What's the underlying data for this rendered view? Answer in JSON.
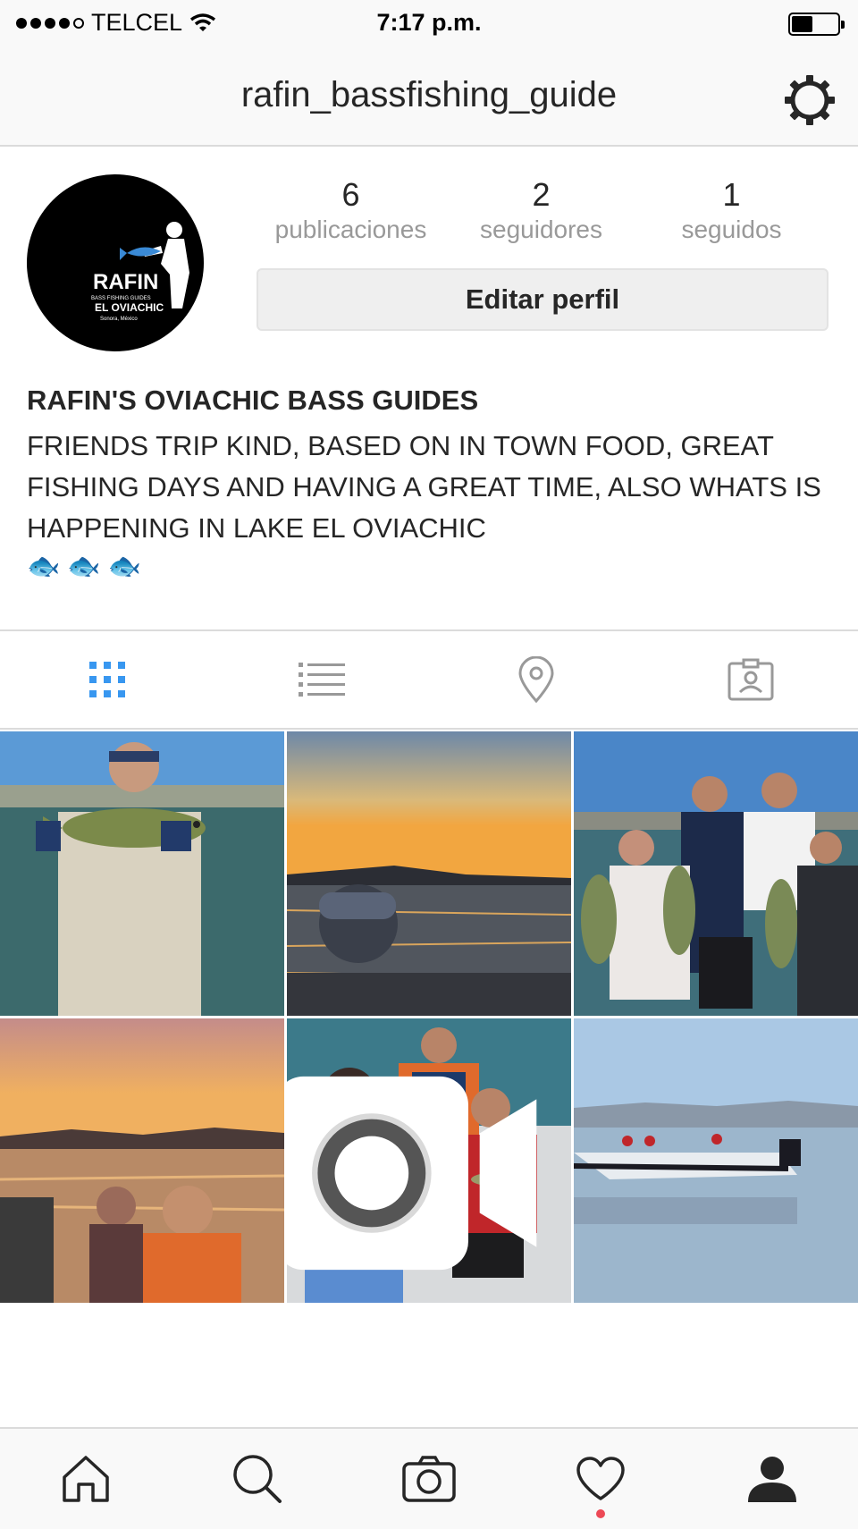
{
  "status_bar": {
    "carrier": "TELCEL",
    "time": "7:17 p.m.",
    "battery_level": 0.45
  },
  "header": {
    "username": "rafin_bassfishing_guide"
  },
  "profile": {
    "avatar_logo_text": "RAFIN BASS FISHING GUIDES EL OVIACHIC Sonora, México",
    "stats": [
      {
        "value": "6",
        "label": "publicaciones"
      },
      {
        "value": "2",
        "label": "seguidores"
      },
      {
        "value": "1",
        "label": "seguidos"
      }
    ],
    "edit_button": "Editar perfil",
    "bio_name": "RAFIN'S OVIACHIC BASS GUIDES",
    "bio_text": "FRIENDS TRIP KIND, BASED ON IN TOWN FOOD, GREAT FISHING DAYS AND HAVING A GREAT TIME, ALSO WHATS IS HAPPENING IN LAKE EL OVIACHIC",
    "bio_emojis": [
      "🐟",
      "🐟",
      "🐟"
    ]
  },
  "tabs": [
    {
      "icon": "grid-icon",
      "active": true
    },
    {
      "icon": "list-icon",
      "active": false
    },
    {
      "icon": "location-pin-icon",
      "active": false
    },
    {
      "icon": "tagged-person-icon",
      "active": false
    }
  ],
  "posts": [
    {
      "scene": "man holding bass on boat",
      "type": "photo"
    },
    {
      "scene": "sunset over lake",
      "type": "photo"
    },
    {
      "scene": "group holding bass fish",
      "type": "photo"
    },
    {
      "scene": "kids at sunset in boat",
      "type": "photo"
    },
    {
      "scene": "kids with fish in boat",
      "type": "video"
    },
    {
      "scene": "bass boat on lake",
      "type": "photo"
    }
  ],
  "bottom_nav": [
    {
      "icon": "home-icon"
    },
    {
      "icon": "search-icon"
    },
    {
      "icon": "camera-icon"
    },
    {
      "icon": "heart-icon",
      "notification": true
    },
    {
      "icon": "profile-icon",
      "active": true
    }
  ],
  "colors": {
    "active_tab": "#3897f0",
    "inactive_icon": "#999999",
    "notification": "#ed4956"
  }
}
